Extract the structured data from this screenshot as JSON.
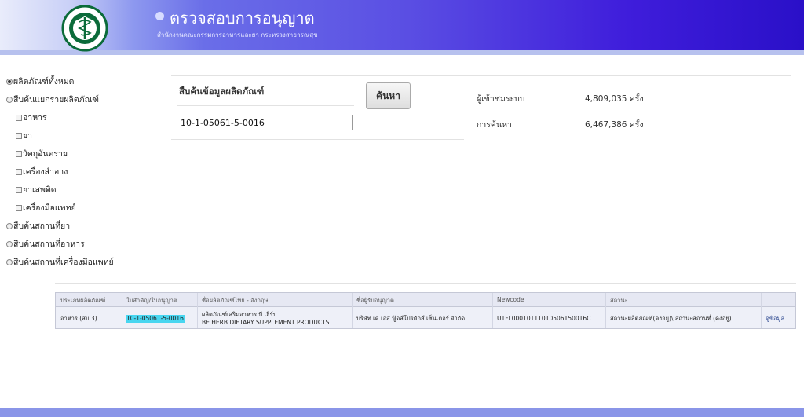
{
  "header": {
    "title": "ตรวจสอบการอนุญาต",
    "subtitle": "สำนักงานคณะกรรมการอาหารและยา กระทรวงสาธารณสุข",
    "logo_text_top": "กระทรวงสาธารณสุข",
    "logo_text_bottom": "MINISTRY OF PUBLIC HEALTH"
  },
  "sidebar": {
    "items": [
      {
        "label": "ผลิตภัณฑ์ทั้งหมด",
        "type": "radio",
        "checked": true
      },
      {
        "label": "สืบค้นแยกรายผลิตภัณฑ์",
        "type": "radio",
        "checked": false
      },
      {
        "label": "อาหาร",
        "type": "checkbox",
        "checked": false
      },
      {
        "label": "ยา",
        "type": "checkbox",
        "checked": false
      },
      {
        "label": "วัตถุอันตราย",
        "type": "checkbox",
        "checked": false
      },
      {
        "label": "เครื่องสำอาง",
        "type": "checkbox",
        "checked": false
      },
      {
        "label": "ยาเสพติด",
        "type": "checkbox",
        "checked": false
      },
      {
        "label": "เครื่องมือแพทย์",
        "type": "checkbox",
        "checked": false
      },
      {
        "label": "สืบค้นสถานที่ยา",
        "type": "radio",
        "checked": false
      },
      {
        "label": "สืบค้นสถานที่อาหาร",
        "type": "radio",
        "checked": false
      },
      {
        "label": "สืบค้นสถานที่เครื่องมือแพทย์",
        "type": "radio",
        "checked": false
      }
    ]
  },
  "search": {
    "title": "สืบค้นข้อมูลผลิตภัณฑ์",
    "value": "10-1-05061-5-0016",
    "button_label": "ค้นหา"
  },
  "stats": {
    "visitors_label": "ผู้เข้าชมระบบ",
    "visitors_value": "4,809,035 ครั้ง",
    "searches_label": "การค้นหา",
    "searches_value": "6,467,386 ครั้ง"
  },
  "results": {
    "headers": [
      "ประเภทผลิตภัณฑ์",
      "ใบสำคัญ/ใบอนุญาต",
      "ชื่อผลิตภัณฑ์ไทย - อังกฤษ",
      "ชื่อผู้รับอนุญาต",
      "Newcode",
      "สถานะ"
    ],
    "rows": [
      {
        "type": "อาหาร (สบ.3)",
        "license": "10-1-05061-5-0016",
        "name_th": "ผลิตภัณฑ์เสริมอาหาร บี เฮิร์บ",
        "name_en": "BE HERB DIETARY SUPPLEMENT PRODUCTS",
        "licensee": "บริษัท เค.เอส.ฟู้ดส์โปรดักส์ เซ็นเตอร์ จำกัด",
        "newcode": "U1FL00010111010506150016C",
        "status": "สถานะผลิตภัณฑ์(คงอยู่)\\ สถานะสถานที่ (คงอยู่)",
        "action": "ดูข้อมูล"
      }
    ]
  },
  "colors": {
    "header_start": "#e9ecfb",
    "header_end": "#2a10c8",
    "footer": "#8a95e8",
    "highlight": "#48d6f0"
  }
}
